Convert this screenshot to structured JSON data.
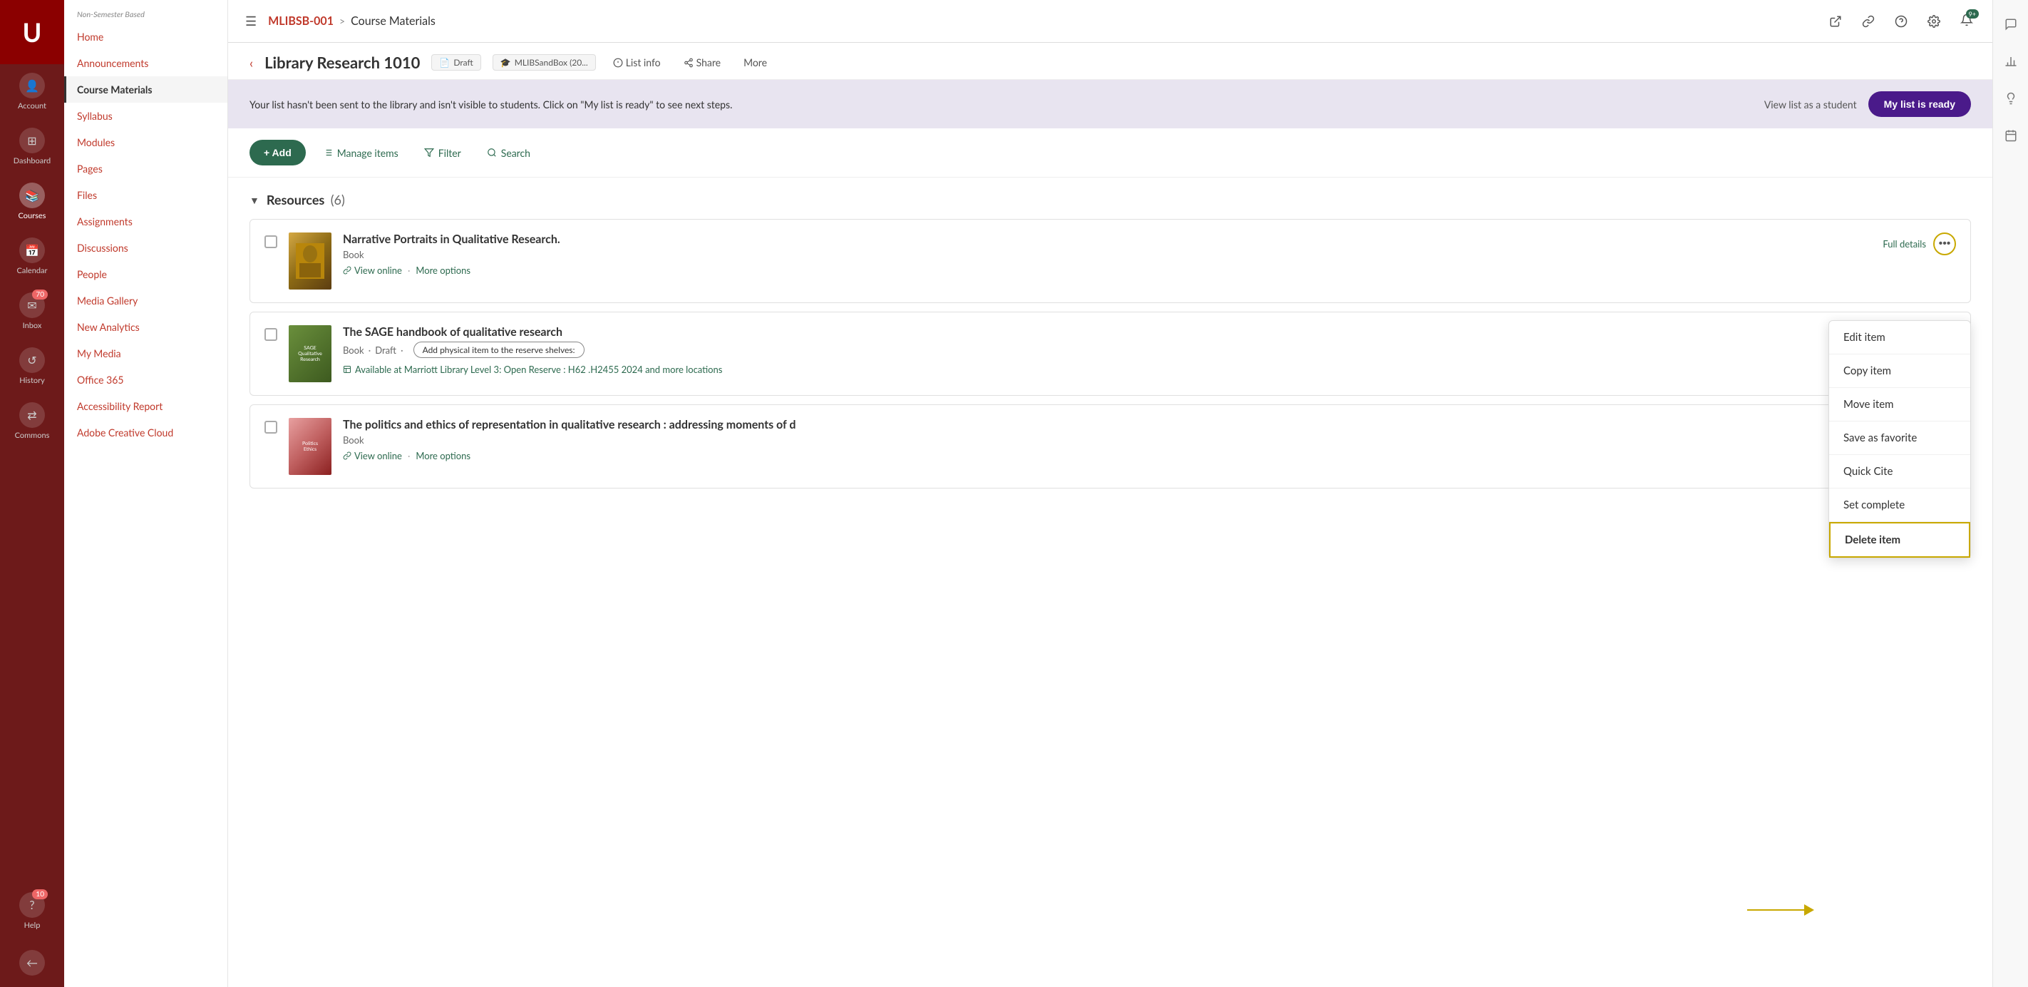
{
  "app": {
    "logo": "U",
    "hamburger_label": "☰"
  },
  "icon_bar": {
    "items": [
      {
        "name": "account",
        "label": "Account",
        "icon": "👤"
      },
      {
        "name": "dashboard",
        "label": "Dashboard",
        "icon": "⊞"
      },
      {
        "name": "courses",
        "label": "Courses",
        "icon": "📚"
      },
      {
        "name": "calendar",
        "label": "Calendar",
        "icon": "📅"
      },
      {
        "name": "inbox",
        "label": "Inbox",
        "icon": "✉",
        "badge": "70"
      },
      {
        "name": "history",
        "label": "History",
        "icon": "↺"
      },
      {
        "name": "commons",
        "label": "Commons",
        "icon": "⇄"
      },
      {
        "name": "help",
        "label": "Help",
        "icon": "⑩",
        "badge": "10"
      }
    ],
    "bottom_item": {
      "name": "collapse",
      "icon": "←"
    }
  },
  "nav_sidebar": {
    "header": "Non-Semester Based",
    "items": [
      {
        "label": "Home",
        "active": false
      },
      {
        "label": "Announcements",
        "active": false
      },
      {
        "label": "Course Materials",
        "active": true
      },
      {
        "label": "Syllabus",
        "active": false
      },
      {
        "label": "Modules",
        "active": false
      },
      {
        "label": "Pages",
        "active": false
      },
      {
        "label": "Files",
        "active": false
      },
      {
        "label": "Assignments",
        "active": false
      },
      {
        "label": "Discussions",
        "active": false
      },
      {
        "label": "People",
        "active": false
      },
      {
        "label": "Media Gallery",
        "active": false
      },
      {
        "label": "New Analytics",
        "active": false
      },
      {
        "label": "My Media",
        "active": false
      },
      {
        "label": "Office 365",
        "active": false
      },
      {
        "label": "Accessibility Report",
        "active": false
      },
      {
        "label": "Adobe Creative Cloud",
        "active": false
      }
    ]
  },
  "top_bar": {
    "breadcrumb_link": "MLIBSB-001",
    "breadcrumb_sep": ">",
    "breadcrumb_current": "Course Materials",
    "icons": [
      "external-link",
      "link",
      "question",
      "gear",
      "notification"
    ]
  },
  "page_header": {
    "back_icon": "‹",
    "title": "Library Research 1010",
    "status": {
      "icon": "📄",
      "label": "Draft"
    },
    "instructor": {
      "icon": "🎓",
      "label": "MLIBSandBox (20..."
    },
    "actions": [
      {
        "label": "List info",
        "icon": "ℹ"
      },
      {
        "label": "Share",
        "icon": "↗"
      },
      {
        "label": "More",
        "icon": "..."
      }
    ]
  },
  "banner": {
    "text": "Your list hasn't been sent to the library and isn't visible to students. Click on \"My list is ready\" to see next steps.",
    "view_student_label": "View list as a student",
    "my_list_label": "My list is ready"
  },
  "toolbar": {
    "add_label": "+ Add",
    "manage_label": "Manage items",
    "filter_label": "Filter",
    "search_label": "Search"
  },
  "resources": {
    "title": "Resources",
    "count": "(6)",
    "items": [
      {
        "id": 1,
        "title": "Narrative Portraits in Qualitative Research.",
        "type": "Book",
        "has_view_online": true,
        "has_more_options": true,
        "full_details_label": "Full details",
        "thumbnail_type": "van-gogh"
      },
      {
        "id": 2,
        "title": "The SAGE handbook of qualitative research",
        "type": "Book",
        "status": "Draft",
        "has_reserve": true,
        "reserve_label": "Add physical item to the reserve shelves:",
        "availability": "Available at Marriott Library Level 3: Open Reserve : H62 .H2455 2024 and more locations",
        "thumbnail_type": "sage"
      },
      {
        "id": 3,
        "title": "The politics and ethics of representation in qualitative research : addressing moments of d",
        "type": "Book",
        "has_view_online": true,
        "has_more_options": true,
        "thumbnail_type": "politics"
      }
    ]
  },
  "dropdown": {
    "items": [
      {
        "label": "Edit item",
        "highlighted": false
      },
      {
        "label": "Copy item",
        "highlighted": false
      },
      {
        "label": "Move item",
        "highlighted": false
      },
      {
        "label": "Save as favorite",
        "highlighted": false
      },
      {
        "label": "Quick Cite",
        "highlighted": false
      },
      {
        "label": "Set complete",
        "highlighted": false
      },
      {
        "label": "Delete item",
        "highlighted": true
      }
    ]
  },
  "right_panel": {
    "icons": [
      "chat",
      "chart",
      "bulb",
      "calendar"
    ]
  }
}
